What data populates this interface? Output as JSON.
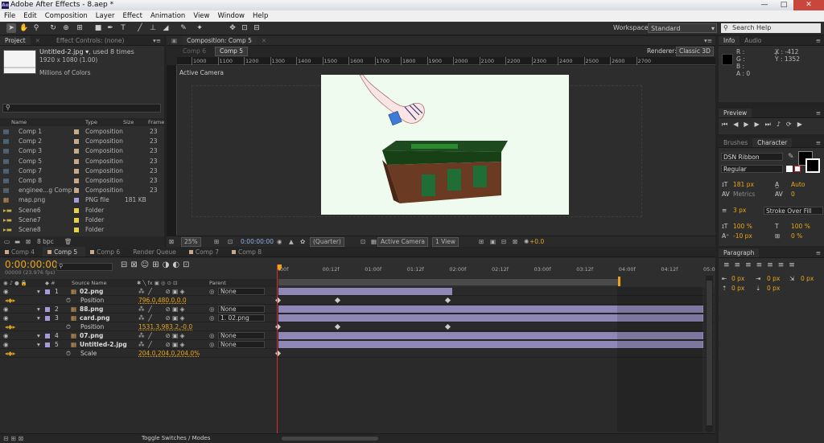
{
  "app": {
    "title": "Adobe After Effects - 8.aep *",
    "icon_text": "Ae"
  },
  "window_controls": {
    "minimize": "—",
    "maximize": "□",
    "close": "✕"
  },
  "menu": [
    "File",
    "Edit",
    "Composition",
    "Layer",
    "Effect",
    "Animation",
    "View",
    "Window",
    "Help"
  ],
  "toolbar": {
    "workspace_label": "Workspace:",
    "workspace_value": "Standard",
    "search_placeholder": "Search Help"
  },
  "project": {
    "tabs": [
      "Project",
      "Effect Controls: (none)"
    ],
    "file_name": "Untitled-2.jpg ▾",
    "used_text": ", used 8 times",
    "dimensions": "1920 x 1080 (1.00)",
    "colors": "Millions of Colors",
    "search_value": "",
    "columns": [
      "Name",
      "Type",
      "Size",
      "Frame"
    ],
    "items": [
      {
        "name": "Comp 1",
        "type": "Composition",
        "size": "",
        "frame": "23",
        "kind": "comp",
        "swatch": "#c8a98a"
      },
      {
        "name": "Comp 2",
        "type": "Composition",
        "size": "",
        "frame": "23",
        "kind": "comp",
        "swatch": "#c8a98a"
      },
      {
        "name": "Comp 3",
        "type": "Composition",
        "size": "",
        "frame": "23",
        "kind": "comp",
        "swatch": "#c8a98a"
      },
      {
        "name": "Comp 5",
        "type": "Composition",
        "size": "",
        "frame": "23",
        "kind": "comp",
        "swatch": "#c8a98a"
      },
      {
        "name": "Comp 7",
        "type": "Composition",
        "size": "",
        "frame": "23",
        "kind": "comp",
        "swatch": "#c8a98a"
      },
      {
        "name": "Comp 8",
        "type": "Composition",
        "size": "",
        "frame": "23",
        "kind": "comp",
        "swatch": "#c8a98a"
      },
      {
        "name": "enginee...g Comp 1",
        "type": "Composition",
        "size": "",
        "frame": "23",
        "kind": "comp",
        "swatch": "#c8a98a"
      },
      {
        "name": "map.png",
        "type": "PNG file",
        "size": "181 KB",
        "frame": "",
        "kind": "file",
        "swatch": "#a89ad8"
      },
      {
        "name": "Scene6",
        "type": "Folder",
        "size": "",
        "frame": "",
        "kind": "folder",
        "swatch": "#e6d24a"
      },
      {
        "name": "Scene7",
        "type": "Folder",
        "size": "",
        "frame": "",
        "kind": "folder",
        "swatch": "#e6d24a"
      },
      {
        "name": "Scene8",
        "type": "Folder",
        "size": "",
        "frame": "",
        "kind": "folder",
        "swatch": "#e6d24a"
      }
    ],
    "bpc": "8 bpc"
  },
  "composition": {
    "tab_label": "Composition: Comp 5",
    "subtabs": [
      "Comp 6",
      "Comp 5"
    ],
    "renderer_label": "Renderer:",
    "renderer_value": "Classic 3D",
    "ruler_ticks": [
      "1000",
      "1100",
      "1200",
      "1300",
      "1400",
      "1500",
      "1600",
      "1700",
      "1800",
      "1900",
      "2000",
      "2100",
      "2200",
      "2300",
      "2400",
      "2500",
      "2600",
      "2700"
    ],
    "view_label": "Active Camera",
    "bottom": {
      "zoom": "25%",
      "timecode": "0:00:00:00",
      "resolution": "(Quarter)",
      "camera": "Active Camera",
      "views": "1 View",
      "exposure": "+0.0"
    }
  },
  "info": {
    "tabs": [
      "Info",
      "Audio"
    ],
    "r": "R :",
    "g": "G :",
    "b": "B :",
    "a": "A : 0",
    "x": "X : -412",
    "y": "Y : 1352"
  },
  "preview": {
    "tab": "Preview"
  },
  "character": {
    "tabs": [
      "Brushes",
      "Character"
    ],
    "font": "DSN Ribbon",
    "style": "Regular",
    "size": "181 px",
    "leading": "Auto",
    "kerning": "Metrics",
    "tracking": "0",
    "stroke_width": "3 px",
    "stroke_type": "Stroke Over Fill",
    "vscale": "100 %",
    "hscale": "100 %",
    "baseline": "-10 px",
    "tsume": "0 %"
  },
  "paragraph": {
    "tab": "Paragraph",
    "v1": "0 px",
    "v2": "0 px",
    "v3": "0 px",
    "v4": "0 px",
    "v5": "0 px"
  },
  "timeline": {
    "tabs": [
      "Comp 4",
      "Comp 5",
      "Comp 6",
      "Render Queue",
      "Comp 7",
      "Comp 8"
    ],
    "timecode": "0:00:00:00",
    "fps": "00000 (23.976 fps)",
    "col_source": "Source Name",
    "col_parent": "Parent",
    "ruler": [
      "00f",
      "00:12f",
      "01:00f",
      "01:12f",
      "02:00f",
      "02:12f",
      "03:00f",
      "03:12f",
      "04:00f",
      "04:12f",
      "05:0"
    ],
    "layers": [
      {
        "num": "1",
        "name": "02.png",
        "parent": "None",
        "type": "layer",
        "bar": [
          0,
          0.41
        ]
      },
      {
        "num": "",
        "name": "Position",
        "value": "796.0,480.0,0.0",
        "type": "prop",
        "keys": [
          0,
          0.14,
          0.4
        ]
      },
      {
        "num": "2",
        "name": "88.png",
        "parent": "None",
        "type": "layer",
        "bar": [
          0,
          1
        ]
      },
      {
        "num": "3",
        "name": "card.png",
        "parent": "1. 02.png",
        "type": "layer",
        "bar": [
          0,
          1
        ]
      },
      {
        "num": "",
        "name": "Position",
        "value": "1531.3,983.2,-0.0",
        "type": "prop",
        "keys": [
          0,
          0.14,
          0.4
        ]
      },
      {
        "num": "4",
        "name": "07.png",
        "parent": "None",
        "type": "layer",
        "bar": [
          0,
          1
        ]
      },
      {
        "num": "5",
        "name": "Untitled-2.jpg",
        "parent": "None",
        "type": "layer",
        "bar": [
          0,
          1
        ]
      },
      {
        "num": "",
        "name": "Scale",
        "value": "204.0,204.0,204.0%",
        "type": "prop",
        "keys": [
          0
        ]
      }
    ],
    "toggle_label": "Toggle Switches / Modes"
  }
}
